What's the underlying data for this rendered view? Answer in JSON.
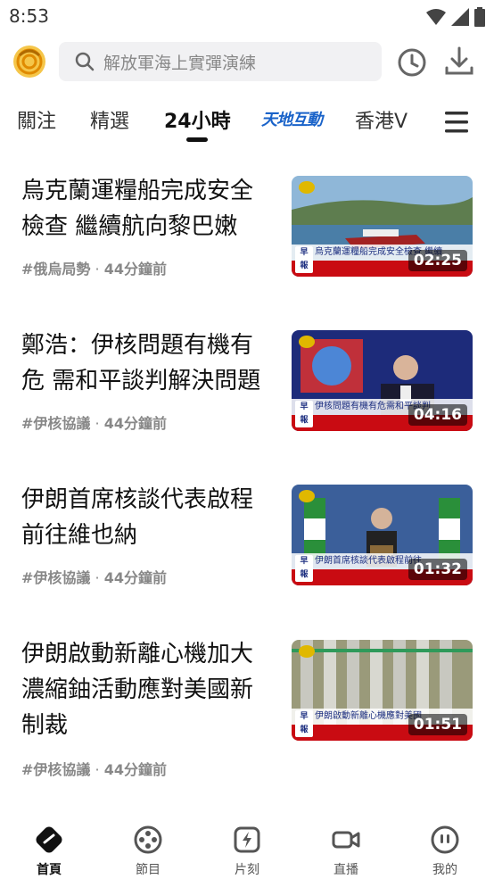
{
  "status_bar": {
    "time": "8:53"
  },
  "search": {
    "placeholder": "解放軍海上實彈演練"
  },
  "tabs": [
    {
      "label": "關注"
    },
    {
      "label": "精選"
    },
    {
      "label": "24小時",
      "active": true
    },
    {
      "label": "天地互動"
    },
    {
      "label": "香港V"
    }
  ],
  "feed": [
    {
      "title_line1": "烏克蘭運糧船完成安全",
      "title_line2": "檢查 繼續航向黎巴嫩",
      "title_line3": "",
      "tag": "#俄烏局勢",
      "time": "44分鐘前",
      "duration": "02:25",
      "ticker_text": "烏克蘭運糧船完成安全檢查 繼續"
    },
    {
      "title_line1": "鄭浩：伊核問題有機有",
      "title_line2": "危 需和平談判解決問題",
      "title_line3": "",
      "tag": "#伊核協議",
      "time": "44分鐘前",
      "duration": "04:16",
      "ticker_text": "伊核問題有機有危需和平談判"
    },
    {
      "title_line1": "伊朗首席核談代表啟程",
      "title_line2": "前往維也納",
      "title_line3": "",
      "tag": "#伊核協議",
      "time": "44分鐘前",
      "duration": "01:32",
      "ticker_text": "伊朗首席核談代表啟程前往"
    },
    {
      "title_line1": "伊朗啟動新離心機加大",
      "title_line2": "濃縮鈾活動應對美國新",
      "title_line3": "制裁",
      "tag": "#伊核協議",
      "time": "44分鐘前",
      "duration": "01:51",
      "ticker_text": "伊朗啟動新離心機應對美國"
    }
  ],
  "bottom_nav": [
    {
      "label": "首頁",
      "active": true
    },
    {
      "label": "節目"
    },
    {
      "label": "片刻"
    },
    {
      "label": "直播"
    },
    {
      "label": "我的"
    }
  ],
  "colors": {
    "brand_blue": "#1a63c9",
    "ticker_red": "#c90b12",
    "logo_gold": "#e0a100"
  }
}
